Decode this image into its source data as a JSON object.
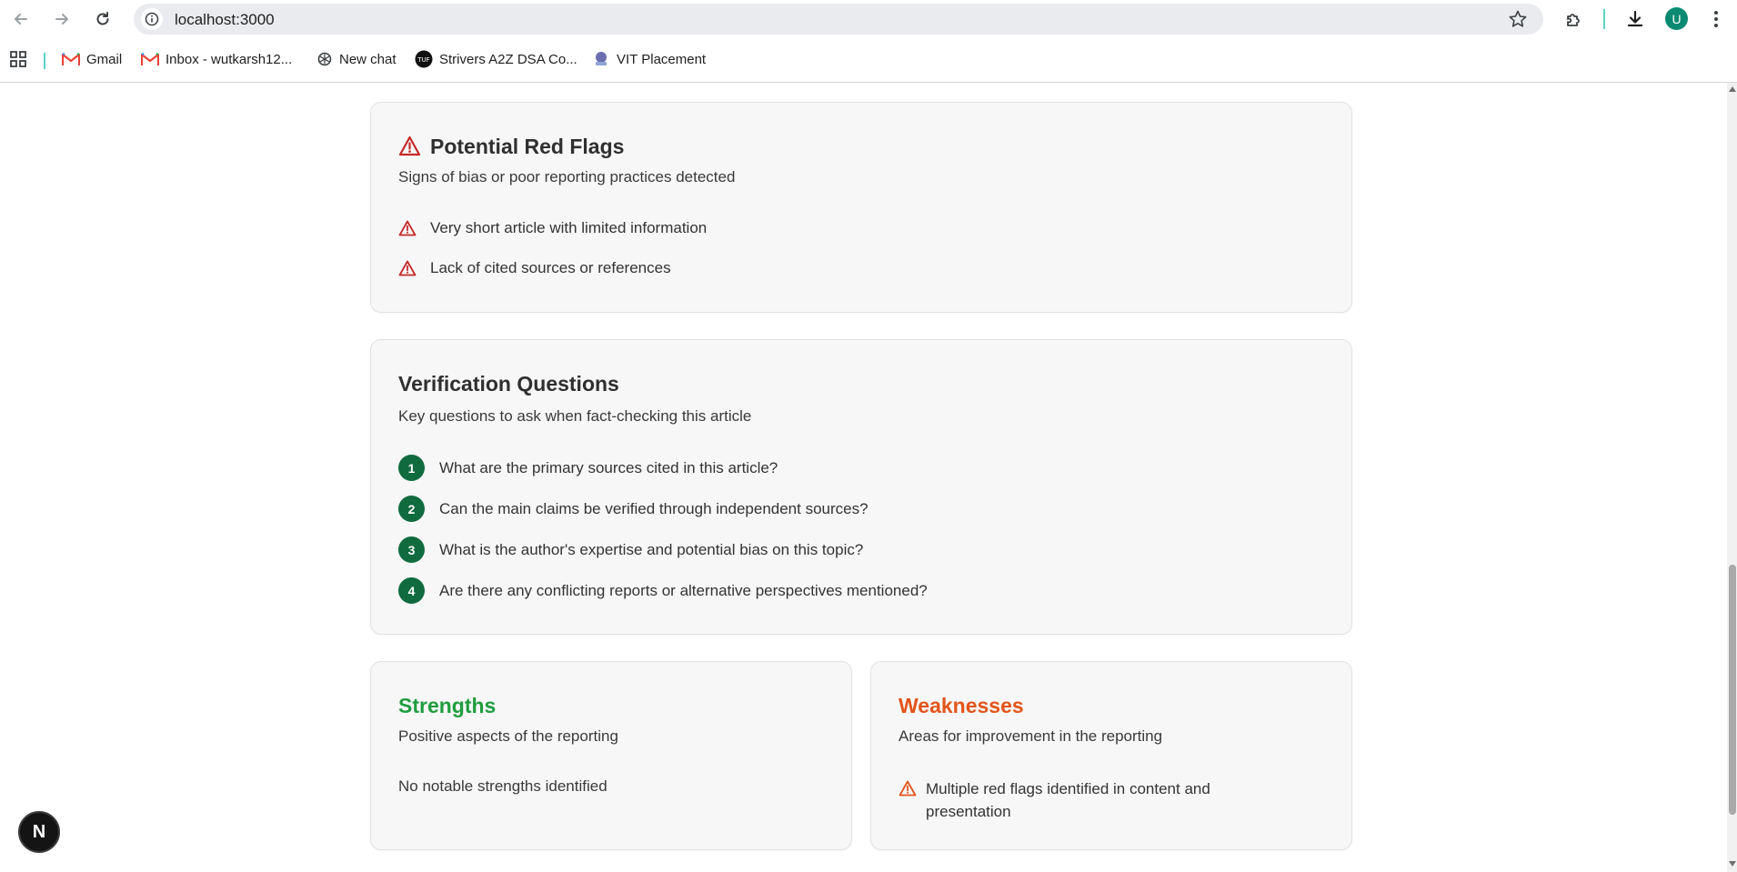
{
  "browser": {
    "url": "localhost:3000",
    "avatar_letter": "U",
    "bookmarks": [
      {
        "label": "Gmail",
        "icon": "gmail-icon"
      },
      {
        "label": "Inbox - wutkarsh12...",
        "icon": "gmail-icon"
      },
      {
        "label": "New chat",
        "icon": "chatgpt-icon"
      },
      {
        "label": "Strivers A2Z DSA Co...",
        "icon": "tuf-icon"
      },
      {
        "label": "VIT Placement",
        "icon": "vit-icon"
      }
    ]
  },
  "red_flags": {
    "title": "Potential Red Flags",
    "subtitle": "Signs of bias or poor reporting practices detected",
    "items": [
      "Very short article with limited information",
      "Lack of cited sources or references"
    ]
  },
  "verification": {
    "title": "Verification Questions",
    "subtitle": "Key questions to ask when fact-checking this article",
    "questions": [
      {
        "n": "1",
        "text": "What are the primary sources cited in this article?"
      },
      {
        "n": "2",
        "text": "Can the main claims be verified through independent sources?"
      },
      {
        "n": "3",
        "text": "What is the author's expertise and potential bias on this topic?"
      },
      {
        "n": "4",
        "text": "Are there any conflicting reports or alternative perspectives mentioned?"
      }
    ]
  },
  "strengths": {
    "title": "Strengths",
    "subtitle": "Positive aspects of the reporting",
    "empty_text": "No notable strengths identified"
  },
  "weaknesses": {
    "title": "Weaknesses",
    "subtitle": "Areas for improvement in the reporting",
    "items": [
      "Multiple red flags identified in content and presentation"
    ]
  },
  "dev_badge": "N",
  "colors": {
    "red_flag": "#c62828",
    "question_badge": "#106b3f",
    "strengths": "#1f9d3f",
    "weaknesses": "#e2541a"
  }
}
